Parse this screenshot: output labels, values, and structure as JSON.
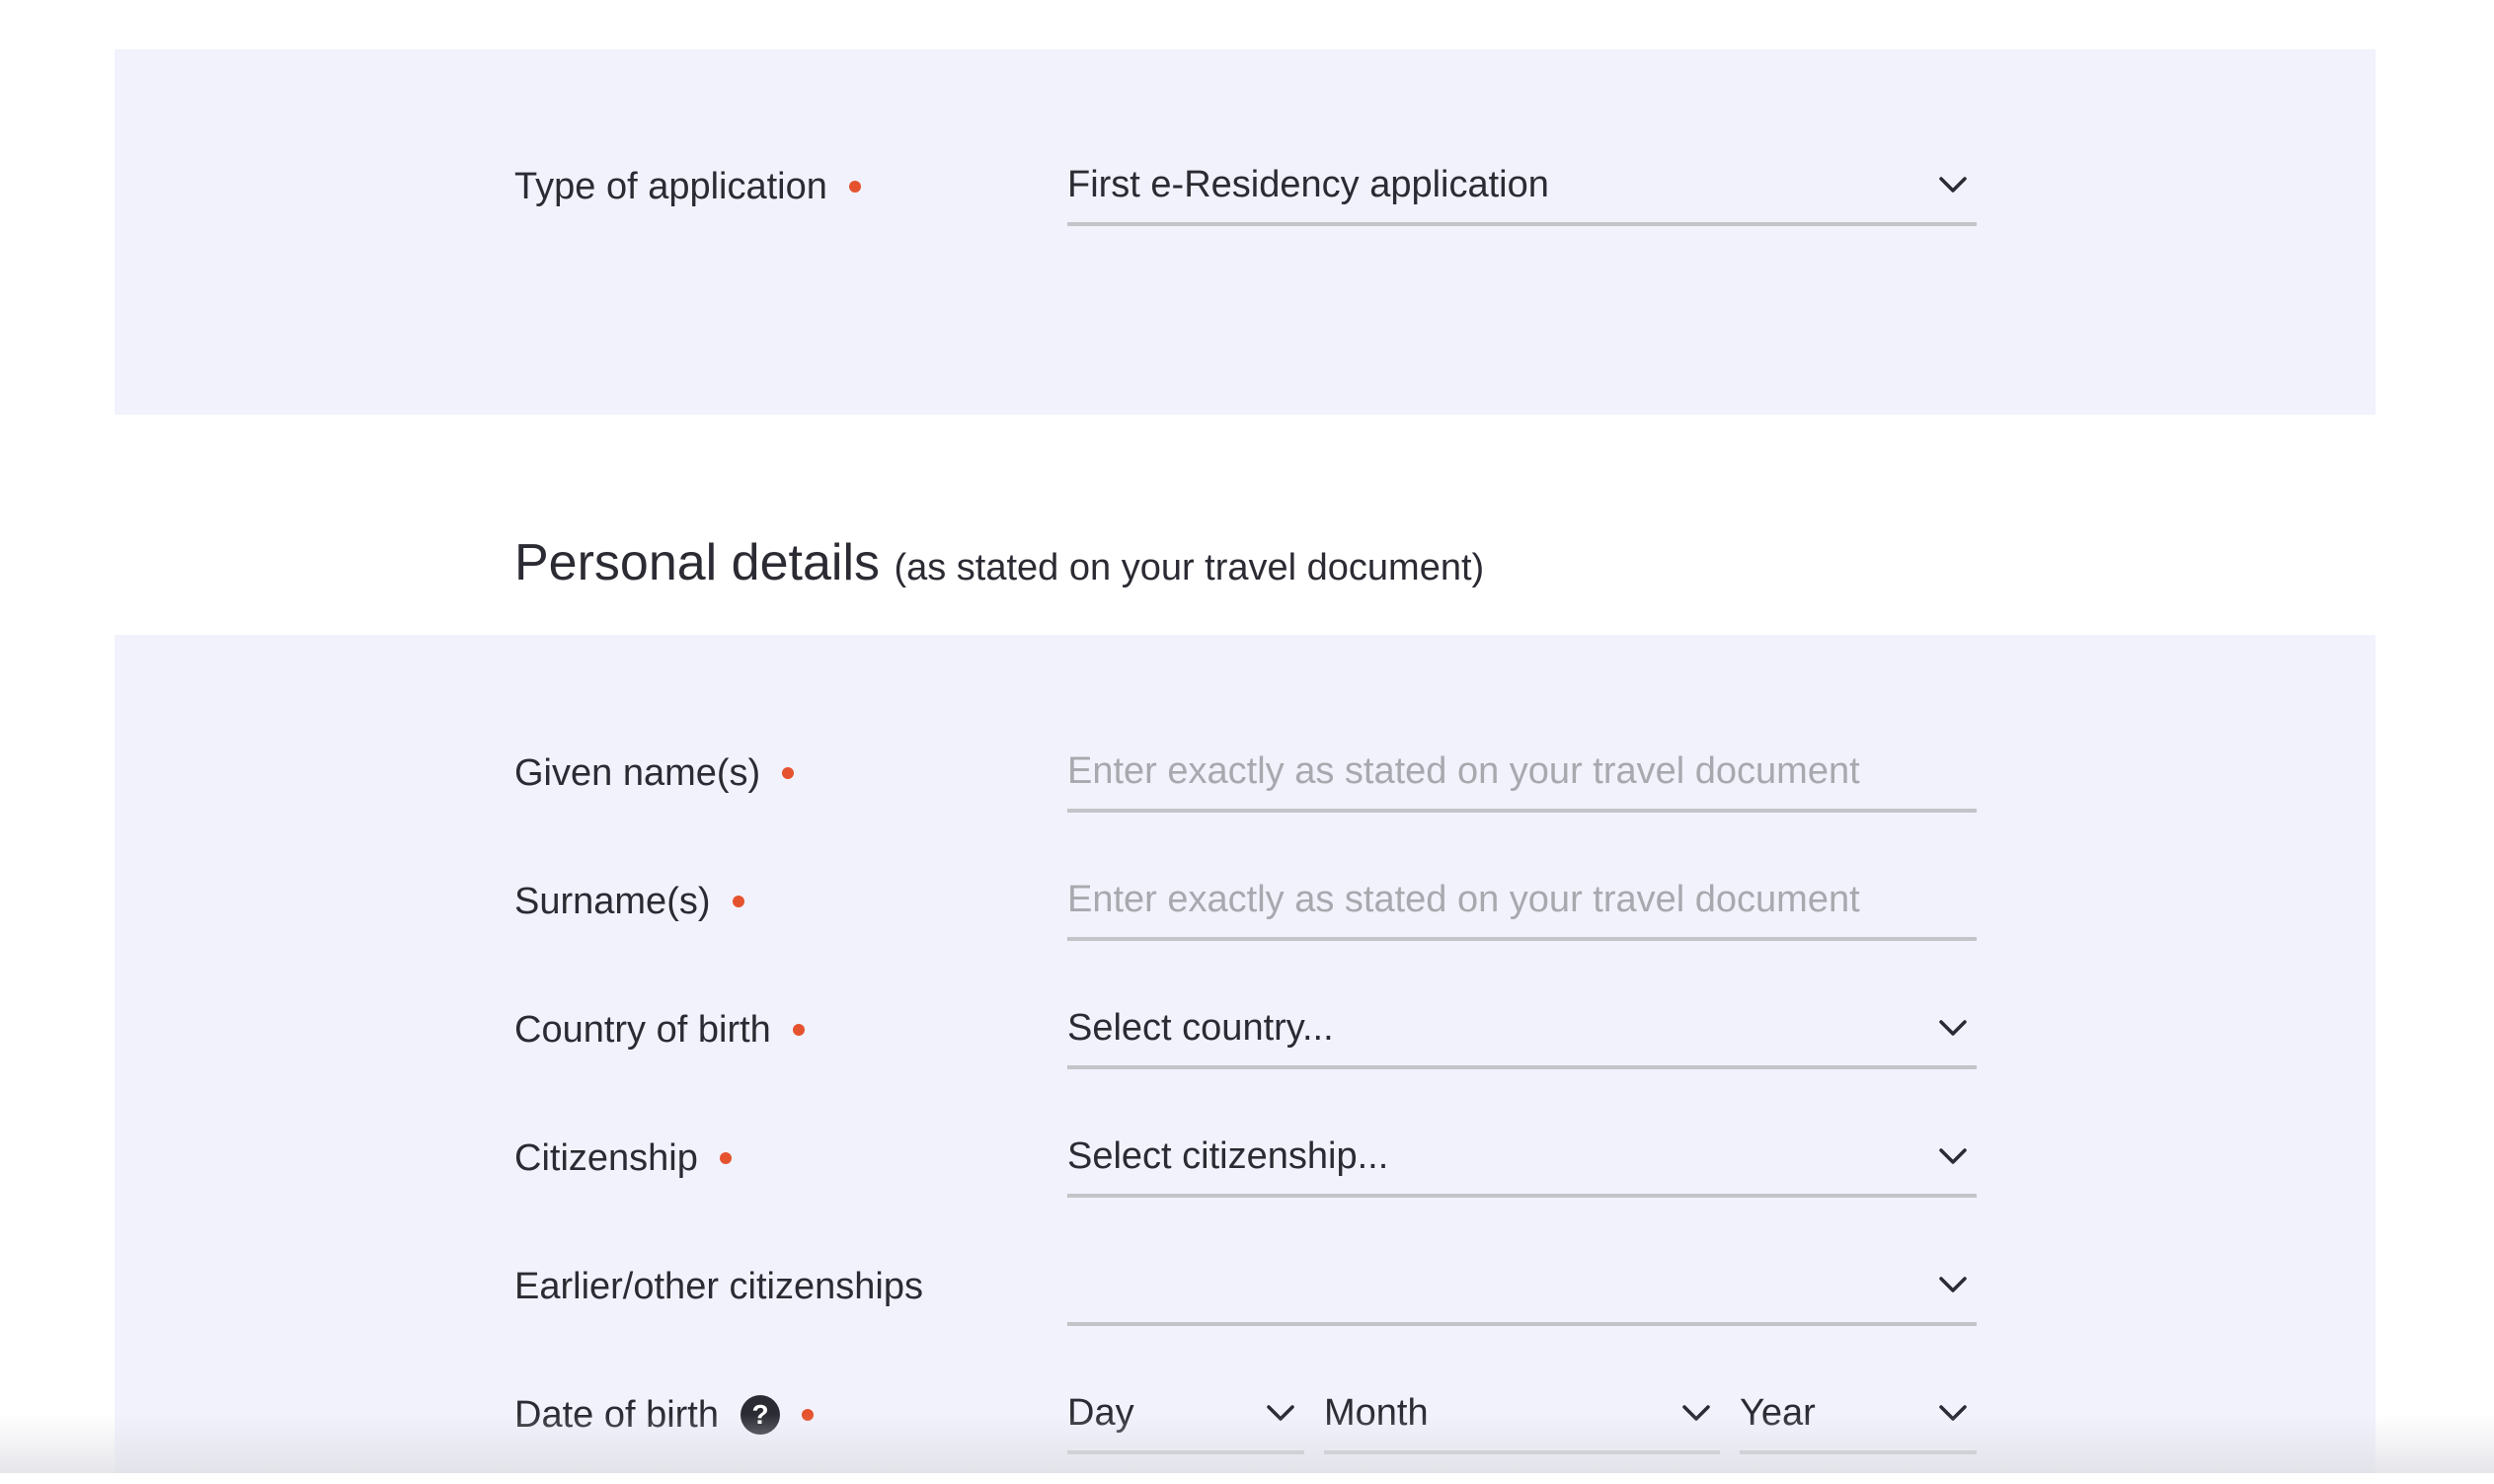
{
  "application": {
    "type_label": "Type of application",
    "type_value": "First e-Residency application"
  },
  "personal": {
    "heading": "Personal details",
    "heading_note": "(as stated on your travel document)",
    "given_names": {
      "label": "Given name(s)",
      "placeholder": "Enter exactly as stated on your travel document"
    },
    "surnames": {
      "label": "Surname(s)",
      "placeholder": "Enter exactly as stated on your travel document"
    },
    "country_of_birth": {
      "label": "Country of birth",
      "value": "Select country..."
    },
    "citizenship": {
      "label": "Citizenship",
      "value": "Select citizenship..."
    },
    "other_citizenships": {
      "label": "Earlier/other citizenships",
      "value": ""
    },
    "date_of_birth": {
      "label": "Date of birth",
      "help": "?",
      "day": "Day",
      "month": "Month",
      "year": "Year"
    }
  },
  "colors": {
    "panel_bg": "#f2f2fd",
    "required_dot": "#e5532e",
    "text": "#2b2b33",
    "placeholder": "#a8a8ae",
    "underline": "#c3c3c8"
  },
  "icons": {
    "dropdown": "chevron-down-icon",
    "required": "required-dot-icon",
    "help": "help-circle-icon"
  }
}
